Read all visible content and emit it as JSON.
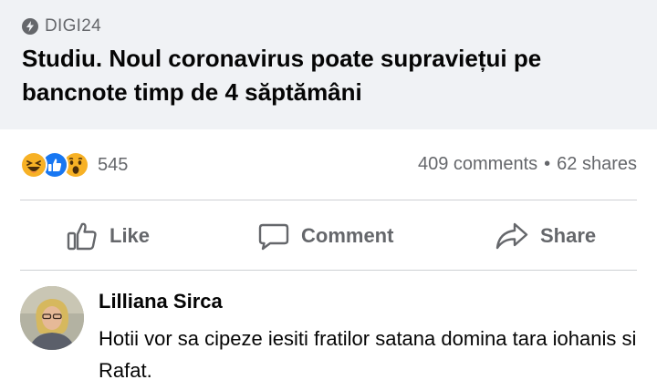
{
  "link_preview": {
    "source_icon": "lightning-bolt-icon",
    "source": "DIGI24",
    "headline": "Studiu. Noul coronavirus poate supraviețui pe bancnote timp de 4 săptămâni"
  },
  "stats": {
    "reactions": [
      {
        "name": "haha-reaction-icon",
        "color": "#f7b125"
      },
      {
        "name": "like-reaction-icon",
        "color": "#1877f2"
      },
      {
        "name": "wow-reaction-icon",
        "color": "#f7b125"
      }
    ],
    "reaction_count": "545",
    "comments": "409 comments",
    "separator": "•",
    "shares": "62 shares"
  },
  "actions": {
    "like": {
      "label": "Like",
      "icon": "thumbs-up-icon"
    },
    "comment": {
      "label": "Comment",
      "icon": "speech-bubble-icon"
    },
    "share": {
      "label": "Share",
      "icon": "share-arrow-icon"
    }
  },
  "comment": {
    "avatar_icon": "user-avatar",
    "author": "Lilliana Sirca",
    "text": "Hotii vor sa cipeze iesiti fratilor satana domina tara iohanis si Rafat."
  },
  "colors": {
    "card_bg": "#f0f2f5",
    "secondary_text": "#65676b",
    "primary_text": "#050505",
    "divider": "#ced0d4"
  }
}
